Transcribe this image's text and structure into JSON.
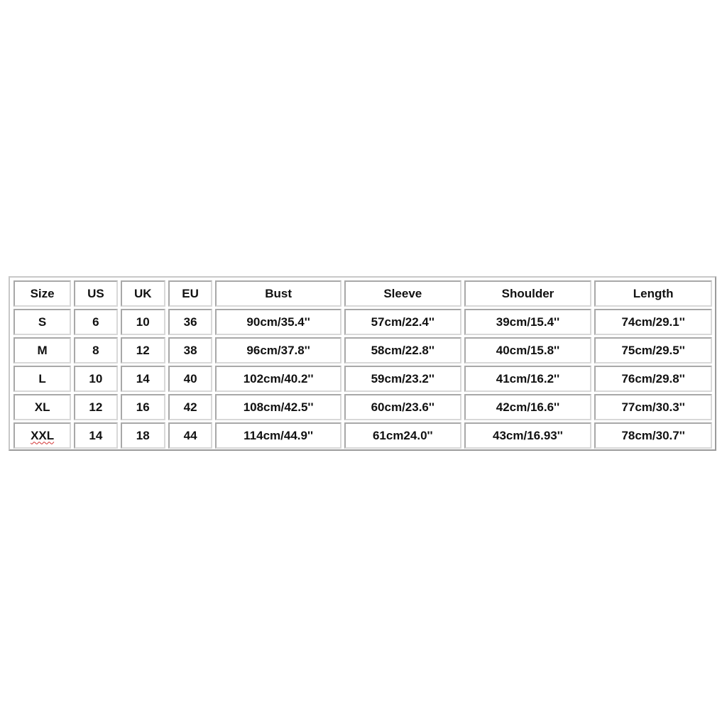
{
  "size_chart": {
    "headers": [
      "Size",
      "US",
      "UK",
      "EU",
      "Bust",
      "Sleeve",
      "Shoulder",
      "Length"
    ],
    "rows": [
      [
        "S",
        "6",
        "10",
        "36",
        "90cm/35.4''",
        "57cm/22.4''",
        "39cm/15.4''",
        "74cm/29.1''"
      ],
      [
        "M",
        "8",
        "12",
        "38",
        "96cm/37.8''",
        "58cm/22.8''",
        "40cm/15.8''",
        "75cm/29.5''"
      ],
      [
        "L",
        "10",
        "14",
        "40",
        "102cm/40.2''",
        "59cm/23.2''",
        "41cm/16.2''",
        "76cm/29.8''"
      ],
      [
        "XL",
        "12",
        "16",
        "42",
        "108cm/42.5''",
        "60cm/23.6''",
        "42cm/16.6''",
        "77cm/30.3''"
      ],
      [
        "XXL",
        "14",
        "18",
        "44",
        "114cm/44.9''",
        "61cm24.0''",
        "43cm/16.93''",
        "78cm/30.7''"
      ]
    ],
    "spellcheck_flagged": [
      "XXL"
    ]
  }
}
